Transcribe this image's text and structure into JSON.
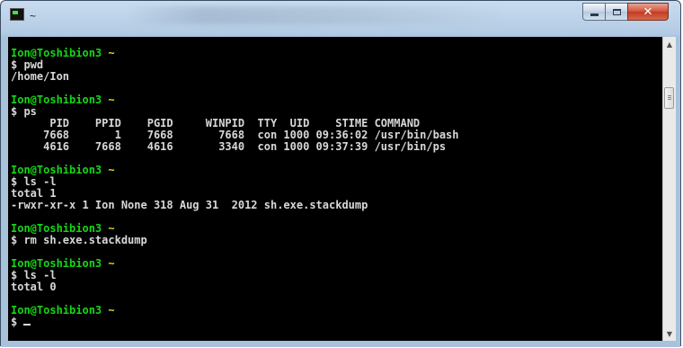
{
  "window": {
    "title": "~",
    "app_icon": "terminal-icon",
    "buttons": {
      "minimize": "minimize-icon",
      "maximize": "maximize-icon",
      "close": "✕"
    }
  },
  "terminal": {
    "colors": {
      "background": "#000000",
      "text": "#d8d8d8",
      "user": "#17d617",
      "path": "#d9d92a"
    },
    "lines": [
      {
        "type": "prompt",
        "user": "Ion@Toshibion3",
        "path": "~"
      },
      {
        "type": "text",
        "text": "$ pwd"
      },
      {
        "type": "text",
        "text": "/home/Ion"
      },
      {
        "type": "blank"
      },
      {
        "type": "prompt",
        "user": "Ion@Toshibion3",
        "path": "~"
      },
      {
        "type": "text",
        "text": "$ ps"
      },
      {
        "type": "text",
        "text": "      PID    PPID    PGID     WINPID  TTY  UID    STIME COMMAND"
      },
      {
        "type": "text",
        "text": "     7668       1    7668       7668  con 1000 09:36:02 /usr/bin/bash"
      },
      {
        "type": "text",
        "text": "     4616    7668    4616       3340  con 1000 09:37:39 /usr/bin/ps"
      },
      {
        "type": "blank"
      },
      {
        "type": "prompt",
        "user": "Ion@Toshibion3",
        "path": "~"
      },
      {
        "type": "text",
        "text": "$ ls -l"
      },
      {
        "type": "text",
        "text": "total 1"
      },
      {
        "type": "text",
        "text": "-rwxr-xr-x 1 Ion None 318 Aug 31  2012 sh.exe.stackdump"
      },
      {
        "type": "blank"
      },
      {
        "type": "prompt",
        "user": "Ion@Toshibion3",
        "path": "~"
      },
      {
        "type": "text",
        "text": "$ rm sh.exe.stackdump"
      },
      {
        "type": "blank"
      },
      {
        "type": "prompt",
        "user": "Ion@Toshibion3",
        "path": "~"
      },
      {
        "type": "text",
        "text": "$ ls -l"
      },
      {
        "type": "text",
        "text": "total 0"
      },
      {
        "type": "blank"
      },
      {
        "type": "prompt",
        "user": "Ion@Toshibion3",
        "path": "~"
      },
      {
        "type": "input",
        "text": "$ "
      }
    ]
  },
  "scrollbar": {
    "up": "▲",
    "down": "▼"
  }
}
